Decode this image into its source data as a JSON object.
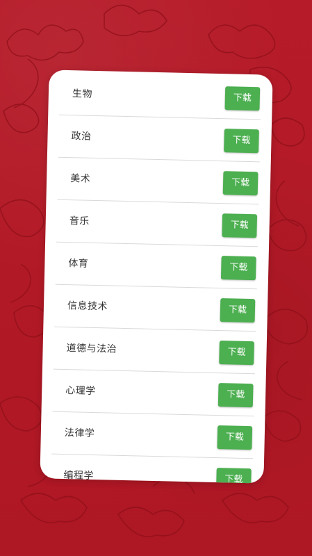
{
  "colors": {
    "background": "#b21a27",
    "card": "#ffffff",
    "button": "#4caf50",
    "button_text": "#ffffff",
    "label_text": "#333333",
    "divider": "#d9d9d9"
  },
  "subjects": [
    {
      "name": "生物",
      "action": "下载"
    },
    {
      "name": "政治",
      "action": "下载"
    },
    {
      "name": "美术",
      "action": "下载"
    },
    {
      "name": "音乐",
      "action": "下载"
    },
    {
      "name": "体育",
      "action": "下载"
    },
    {
      "name": "信息技术",
      "action": "下载"
    },
    {
      "name": "道德与法治",
      "action": "下载"
    },
    {
      "name": "心理学",
      "action": "下载"
    },
    {
      "name": "法律学",
      "action": "下载"
    },
    {
      "name": "编程学",
      "action": "下载"
    }
  ]
}
